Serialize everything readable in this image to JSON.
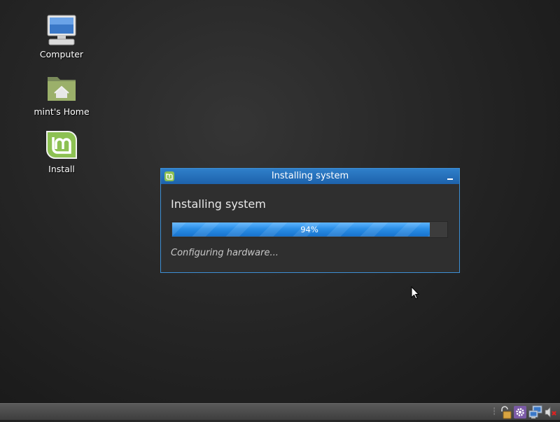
{
  "desktop": {
    "icons": [
      {
        "label": "Computer",
        "icon": "computer-icon"
      },
      {
        "label": "mint's Home",
        "icon": "home-folder-icon"
      },
      {
        "label": "Install",
        "icon": "linux-mint-logo-icon"
      }
    ]
  },
  "dialog": {
    "title": "Installing system",
    "heading": "Installing system",
    "progress": {
      "value": 94,
      "label": "94%"
    },
    "status": "Configuring hardware...",
    "minimize_icon": "minimize-icon",
    "app_icon": "linux-mint-logo-icon"
  },
  "taskbar": {
    "tray": [
      {
        "icon": "lock-icon"
      },
      {
        "icon": "settings-gear-icon"
      },
      {
        "icon": "network-icon"
      },
      {
        "icon": "volume-muted-icon"
      }
    ]
  },
  "colors": {
    "accent": "#2f7fca",
    "progress_fill": "#2a8ee6",
    "mint_green": "#8dc153"
  }
}
